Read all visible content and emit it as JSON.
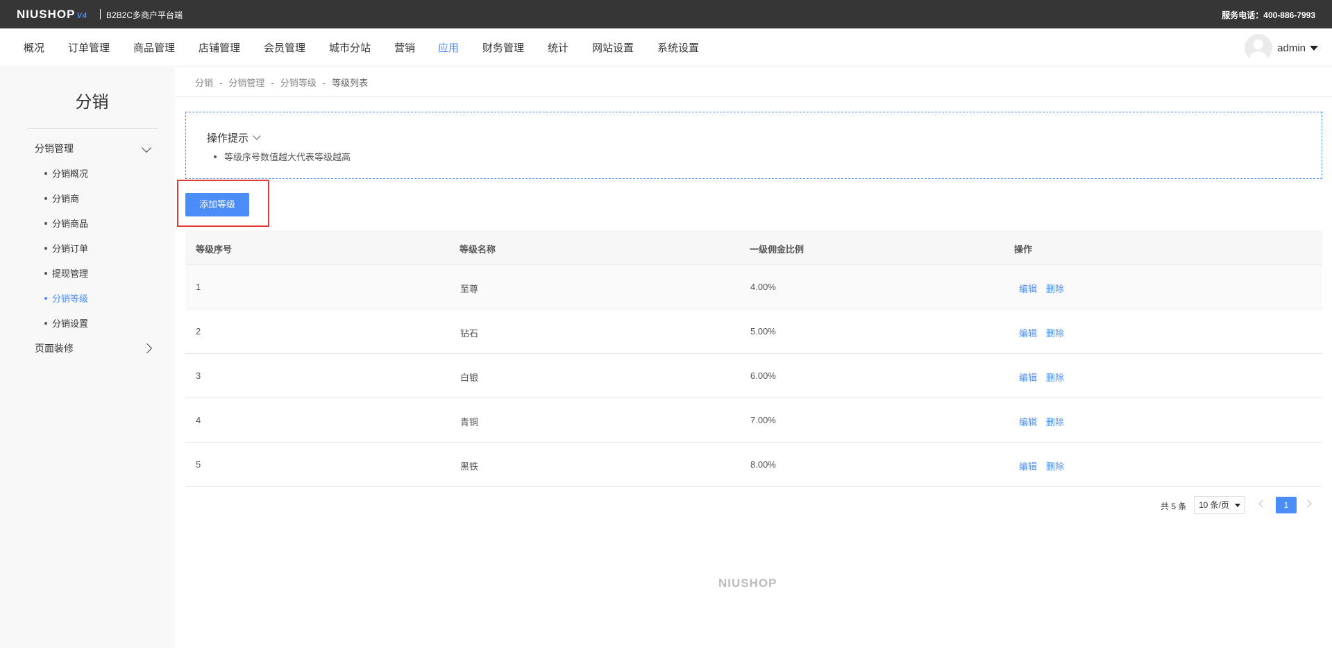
{
  "topbar": {
    "logo": "NIUSHOP",
    "logo_version": "V4",
    "subtitle": "B2B2C多商户平台端",
    "phone": "服务电话：400-886-7993"
  },
  "nav": {
    "items": [
      "概况",
      "订单管理",
      "商品管理",
      "店铺管理",
      "会员管理",
      "城市分站",
      "营销",
      "应用",
      "财务管理",
      "统计",
      "网站设置",
      "系统设置"
    ],
    "active": "应用",
    "user": "admin"
  },
  "sidebar": {
    "title": "分销",
    "group1": "分销管理",
    "items": [
      "分销概况",
      "分销商",
      "分销商品",
      "分销订单",
      "提现管理",
      "分销等级",
      "分销设置"
    ],
    "active": "分销等级",
    "group2": "页面装修"
  },
  "breadcrumb": [
    "分销",
    "分销管理",
    "分销等级",
    "等级列表"
  ],
  "breadcrumb_sep": "-",
  "tips": {
    "title": "操作提示",
    "items": [
      "等级序号数值越大代表等级越高"
    ]
  },
  "add_button": "添加等级",
  "table": {
    "headers": [
      "等级序号",
      "等级名称",
      "一级佣金比例",
      "操作"
    ],
    "rows": [
      {
        "no": "1",
        "name": "至尊",
        "ratio": "4.00%"
      },
      {
        "no": "2",
        "name": "钻石",
        "ratio": "5.00%"
      },
      {
        "no": "3",
        "name": "白银",
        "ratio": "6.00%"
      },
      {
        "no": "4",
        "name": "青铜",
        "ratio": "7.00%"
      },
      {
        "no": "5",
        "name": "黑铁",
        "ratio": "8.00%"
      }
    ],
    "edit_label": "编辑",
    "delete_label": "删除"
  },
  "pagination": {
    "total": "共 5 条",
    "page_size": "10 条/页",
    "current": "1"
  },
  "footer_logo": "NIUSHOP",
  "colors": {
    "accent": "#4b8df8",
    "topbar": "#363636",
    "highlight": "#e53935"
  }
}
